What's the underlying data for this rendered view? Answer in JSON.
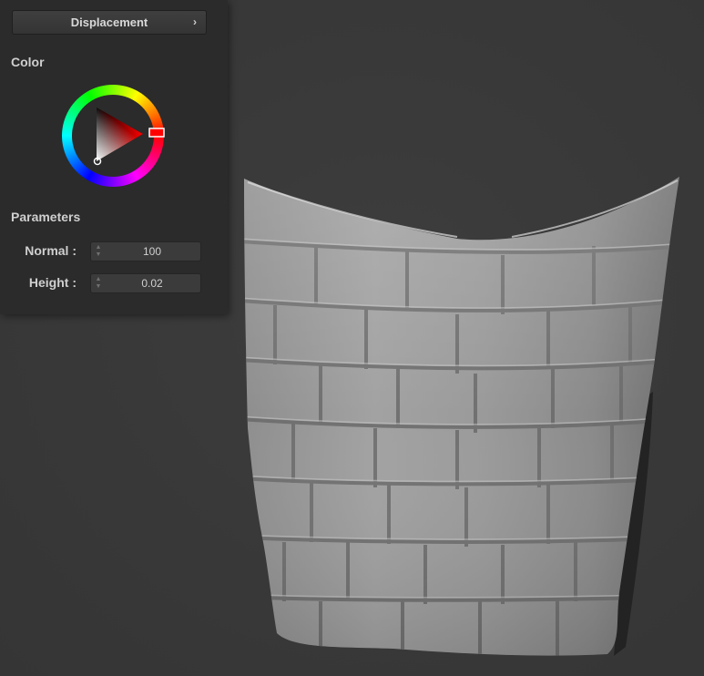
{
  "panel": {
    "dropdown_label": "Displacement",
    "dropdown_chevron": "›",
    "color_title": "Color",
    "parameters_title": "Parameters",
    "params": [
      {
        "label": "Normal :",
        "value": "100"
      },
      {
        "label": "Height :",
        "value": "0.02"
      }
    ]
  },
  "color_picker": {
    "selected_hue": "#ff0000",
    "icon": "hue-ring-with-triangle"
  },
  "viewport": {
    "object": "draped-cloth-with-brick-displacement",
    "background": "#393939"
  }
}
